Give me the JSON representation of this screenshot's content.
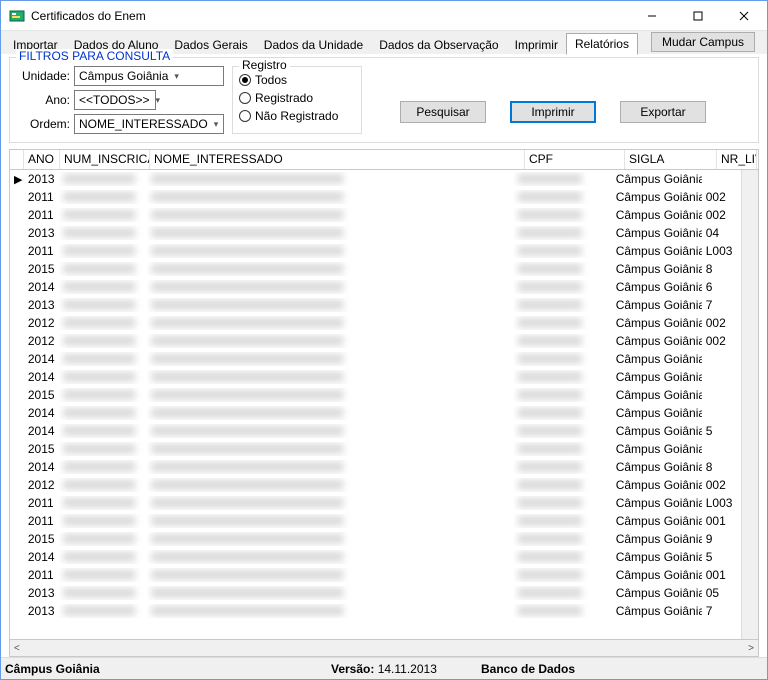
{
  "window": {
    "title": "Certificados do Enem"
  },
  "tabs": [
    "Importar",
    "Dados do Aluno",
    "Dados Gerais",
    "Dados da Unidade",
    "Dados da Observação",
    "Imprimir",
    "Relatórios"
  ],
  "active_tab_index": 6,
  "change_campus": "Mudar Campus",
  "fieldset_title": "FILTROS PARA CONSULTA",
  "filters": {
    "unidade_label": "Unidade:",
    "unidade_value": "Câmpus Goiânia",
    "ano_label": "Ano:",
    "ano_value": "<<TODOS>>",
    "ordem_label": "Ordem:",
    "ordem_value": "NOME_INTERESSADO"
  },
  "registro": {
    "legend": "Registro",
    "options": [
      "Todos",
      "Registrado",
      "Não Registrado"
    ],
    "selected": 0
  },
  "buttons": {
    "pesquisar": "Pesquisar",
    "imprimir": "Imprimir",
    "exportar": "Exportar"
  },
  "grid": {
    "columns": [
      "ANO",
      "NUM_INSCRICAO",
      "NOME_INTERESSADO",
      "CPF",
      "SIGLA",
      "NR_LIV"
    ],
    "rows": [
      {
        "marker": "▶",
        "ano": "2013",
        "sigla": "Câmpus Goiânia",
        "nr": ""
      },
      {
        "marker": "",
        "ano": "2011",
        "sigla": "Câmpus Goiânia",
        "nr": "002"
      },
      {
        "marker": "",
        "ano": "2011",
        "sigla": "Câmpus Goiânia",
        "nr": "002"
      },
      {
        "marker": "",
        "ano": "2013",
        "sigla": "Câmpus Goiânia",
        "nr": "04"
      },
      {
        "marker": "",
        "ano": "2011",
        "sigla": "Câmpus Goiânia",
        "nr": "L003"
      },
      {
        "marker": "",
        "ano": "2015",
        "sigla": "Câmpus Goiânia",
        "nr": "8"
      },
      {
        "marker": "",
        "ano": "2014",
        "sigla": "Câmpus Goiânia",
        "nr": "6"
      },
      {
        "marker": "",
        "ano": "2013",
        "sigla": "Câmpus Goiânia",
        "nr": "7"
      },
      {
        "marker": "",
        "ano": "2012",
        "sigla": "Câmpus Goiânia",
        "nr": "002"
      },
      {
        "marker": "",
        "ano": "2012",
        "sigla": "Câmpus Goiânia",
        "nr": "002"
      },
      {
        "marker": "",
        "ano": "2014",
        "sigla": "Câmpus Goiânia",
        "nr": ""
      },
      {
        "marker": "",
        "ano": "2014",
        "sigla": "Câmpus Goiânia",
        "nr": ""
      },
      {
        "marker": "",
        "ano": "2015",
        "sigla": "Câmpus Goiânia",
        "nr": ""
      },
      {
        "marker": "",
        "ano": "2014",
        "sigla": "Câmpus Goiânia",
        "nr": ""
      },
      {
        "marker": "",
        "ano": "2014",
        "sigla": "Câmpus Goiânia",
        "nr": "5"
      },
      {
        "marker": "",
        "ano": "2015",
        "sigla": "Câmpus Goiânia",
        "nr": ""
      },
      {
        "marker": "",
        "ano": "2014",
        "sigla": "Câmpus Goiânia",
        "nr": "8"
      },
      {
        "marker": "",
        "ano": "2012",
        "sigla": "Câmpus Goiânia",
        "nr": "002"
      },
      {
        "marker": "",
        "ano": "2011",
        "sigla": "Câmpus Goiânia",
        "nr": "L003"
      },
      {
        "marker": "",
        "ano": "2011",
        "sigla": "Câmpus Goiânia",
        "nr": "001"
      },
      {
        "marker": "",
        "ano": "2015",
        "sigla": "Câmpus Goiânia",
        "nr": "9"
      },
      {
        "marker": "",
        "ano": "2014",
        "sigla": "Câmpus Goiânia",
        "nr": "5"
      },
      {
        "marker": "",
        "ano": "2011",
        "sigla": "Câmpus Goiânia",
        "nr": "001"
      },
      {
        "marker": "",
        "ano": "2013",
        "sigla": "Câmpus Goiânia",
        "nr": "05"
      },
      {
        "marker": "",
        "ano": "2013",
        "sigla": "Câmpus Goiânia",
        "nr": "7"
      }
    ]
  },
  "status": {
    "campus": "Câmpus Goiânia",
    "versao_label": "Versão:",
    "versao": "14.11.2013",
    "db": "Banco de Dados"
  }
}
